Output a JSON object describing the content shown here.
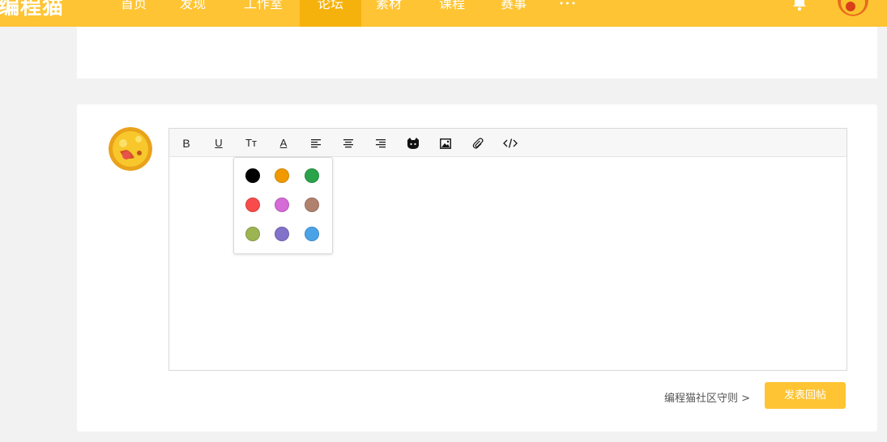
{
  "header": {
    "logo": "编程猫",
    "nav": [
      {
        "label": "首页"
      },
      {
        "label": "发现"
      },
      {
        "label": "工作室"
      },
      {
        "label": "论坛",
        "active": true
      },
      {
        "label": "素材"
      },
      {
        "label": "课程"
      },
      {
        "label": "赛事"
      },
      {
        "label": "•••"
      }
    ]
  },
  "toolbar": {
    "bold": "B",
    "underline": "U",
    "text_size": "Tт",
    "font_color": "A"
  },
  "colors": {
    "brand": "#fec433",
    "nav_active": "#f6b20c",
    "swatches": [
      "#000000",
      "#f09a00",
      "#2aa34a",
      "#f94b4b",
      "#d46bd6",
      "#b0826d",
      "#9cb452",
      "#8372c9",
      "#4aa3e6"
    ]
  },
  "footer": {
    "rules_link": "编程猫社区守则 >",
    "submit_label": "发表回帖"
  }
}
